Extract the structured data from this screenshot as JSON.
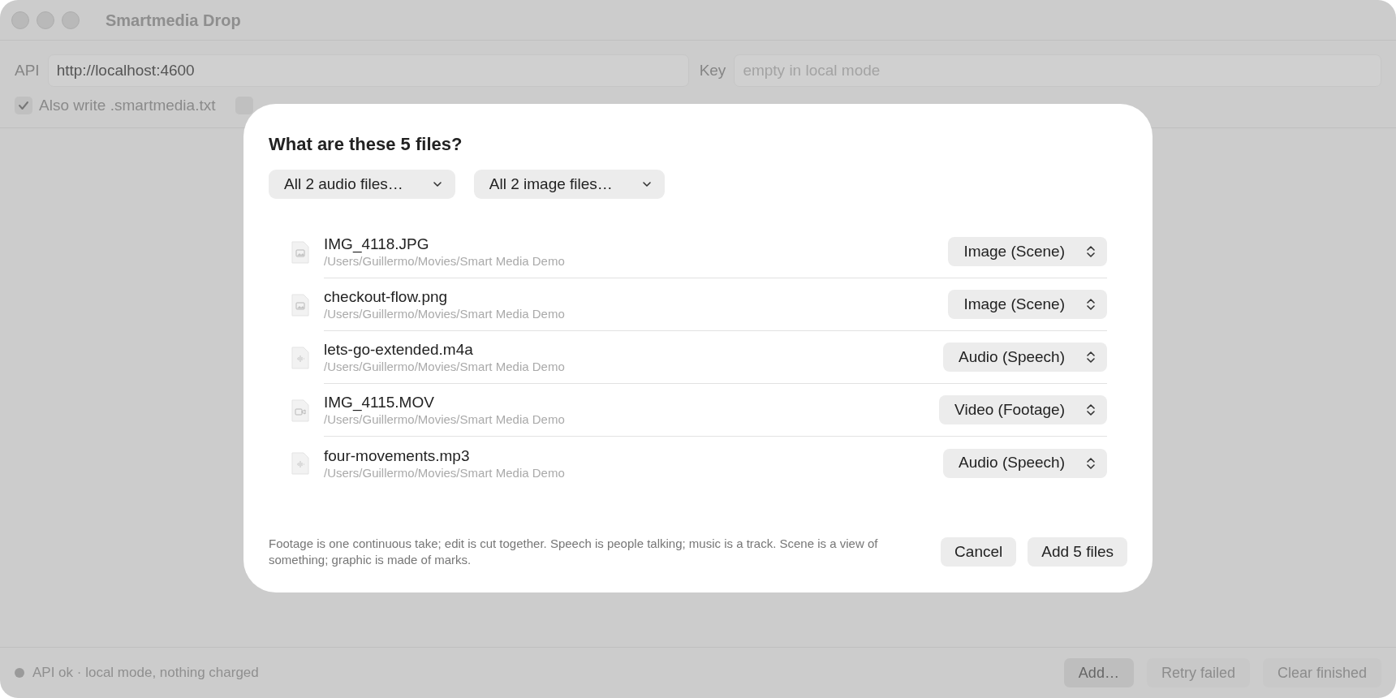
{
  "window": {
    "title": "Smartmedia Drop"
  },
  "settings": {
    "api": {
      "label": "API",
      "value": "http://localhost:4600"
    },
    "key": {
      "label": "Key",
      "placeholder": "empty in local mode"
    },
    "options": [
      {
        "label": "Also write .smartmedia.txt",
        "checked": true
      },
      {
        "checked": false
      }
    ]
  },
  "dialog": {
    "title": "What are these 5 files?",
    "bulk_menus": [
      "All 2 audio files…",
      "All 2 image files…"
    ],
    "files": [
      {
        "name": "IMG_4118.JPG",
        "path": "/Users/Guillermo/Movies/Smart Media Demo",
        "kind": "image",
        "type": "Image (Scene)"
      },
      {
        "name": "checkout-flow.png",
        "path": "/Users/Guillermo/Movies/Smart Media Demo",
        "kind": "image",
        "type": "Image (Scene)"
      },
      {
        "name": "lets-go-extended.m4a",
        "path": "/Users/Guillermo/Movies/Smart Media Demo",
        "kind": "audio",
        "type": "Audio (Speech)"
      },
      {
        "name": "IMG_4115.MOV",
        "path": "/Users/Guillermo/Movies/Smart Media Demo",
        "kind": "video",
        "type": "Video (Footage)"
      },
      {
        "name": "four-movements.mp3",
        "path": "/Users/Guillermo/Movies/Smart Media Demo",
        "kind": "audio",
        "type": "Audio (Speech)"
      }
    ],
    "hint": "Footage is one continuous take; edit is cut together. Speech is people talking; music is a track. Scene is a view of something; graphic is made of marks.",
    "buttons": [
      "Cancel",
      "Add 5 files"
    ]
  },
  "status_bar": {
    "text": "API ok · local mode, nothing charged",
    "buttons": [
      {
        "label": "Add…",
        "disabled": false
      },
      {
        "label": "Retry failed",
        "disabled": true
      },
      {
        "label": "Clear finished",
        "disabled": true
      }
    ]
  }
}
